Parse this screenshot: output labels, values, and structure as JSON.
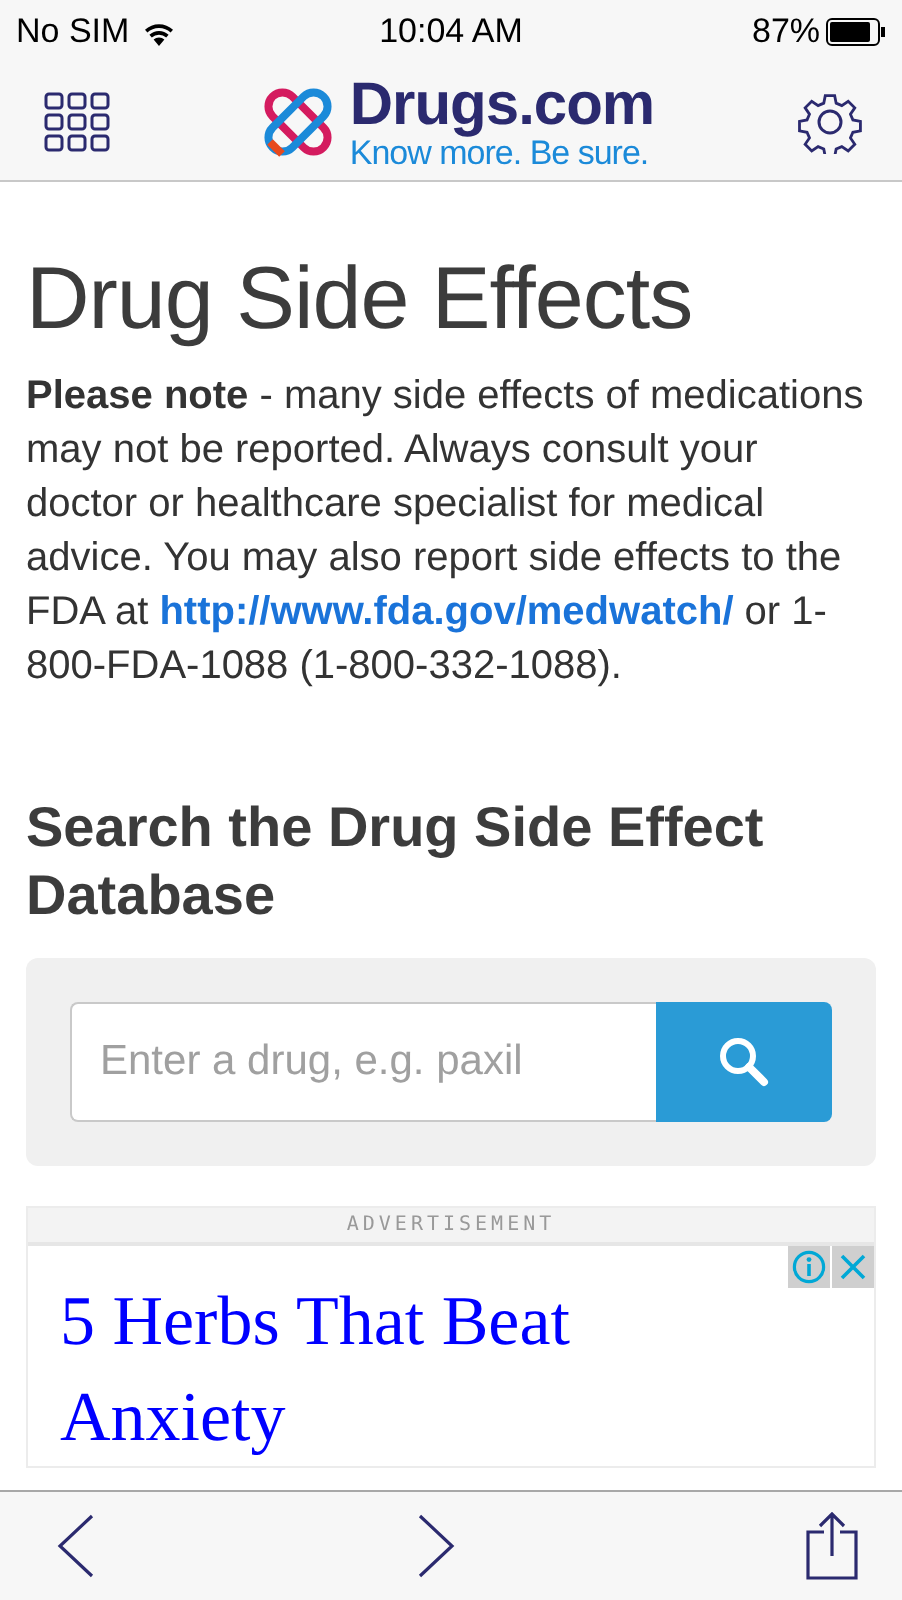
{
  "status_bar": {
    "carrier": "No SIM",
    "time": "10:04 AM",
    "battery": "87%"
  },
  "header": {
    "logo_name": "Drugs.com",
    "logo_tagline": "Know more. Be sure."
  },
  "page": {
    "title": "Drug Side Effects",
    "note": "**Please note** - many side effects of medications may not be reported. Always consult your doctor or healthcare specialist for medical advice. You may also report side effects to the FDA at",
    "link": "http://www.fda.gov/medwatch/",
    "note_end": "or 1-800-FDA-1088 (1-800-332-1088)."
  },
  "search": {
    "heading": "Search the Drug Side Effect Database",
    "placeholder": "Enter a drug, e.g. paxil"
  },
  "ad": {
    "label": "ADVERTISEMENT",
    "headline": "5 Herbs That Beat Anxiety"
  }
}
